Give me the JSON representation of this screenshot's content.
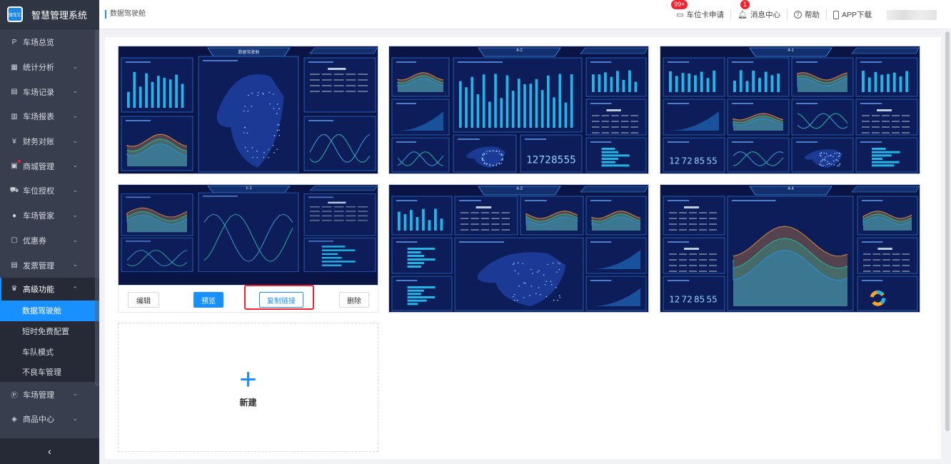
{
  "app": {
    "title": "智慧管理系统",
    "logo_text": "驿车汇"
  },
  "sidebar": {
    "items": [
      {
        "label": "车场总览",
        "icon": "parking-overview-icon"
      },
      {
        "label": "统计分析",
        "icon": "chart-icon"
      },
      {
        "label": "车场记录",
        "icon": "record-icon"
      },
      {
        "label": "车场报表",
        "icon": "report-icon"
      },
      {
        "label": "财务对账",
        "icon": "finance-icon"
      },
      {
        "label": "商城管理",
        "icon": "store-icon"
      },
      {
        "label": "车位授权",
        "icon": "car-icon"
      },
      {
        "label": "车场管家",
        "icon": "user-icon"
      },
      {
        "label": "优惠券",
        "icon": "coupon-icon"
      },
      {
        "label": "发票管理",
        "icon": "invoice-icon"
      }
    ],
    "open_group": {
      "label": "高级功能",
      "icon": "crown-icon",
      "children": [
        "数据驾驶舱",
        "短时免费配置",
        "车队模式",
        "不良车管理"
      ]
    },
    "after": [
      {
        "label": "车场管理",
        "icon": "parking-icon"
      },
      {
        "label": "商品中心",
        "icon": "layers-icon"
      }
    ],
    "collapse": "‹"
  },
  "header": {
    "breadcrumb": "数据驾驶舱",
    "items": [
      {
        "label": "车位卡申请",
        "badge": "99+"
      },
      {
        "label": "消息中心",
        "badge": "1"
      },
      {
        "label": "帮助"
      },
      {
        "label": "APP下载"
      }
    ]
  },
  "dashboards": [
    {
      "title": "数据驾驶舱"
    },
    {
      "title": "4-2"
    },
    {
      "title": "4-1"
    },
    {
      "title": "1-1"
    },
    {
      "title": "4-3"
    },
    {
      "title": "4-4"
    }
  ],
  "actions": {
    "edit": "编辑",
    "preview": "预览",
    "copy_link": "复制链接",
    "delete": "删除"
  },
  "new_card": {
    "plus": "+",
    "label": "新建"
  },
  "colors": {
    "accent": "#1890ff",
    "sidebar": "#393e4e",
    "danger": "#f5222d"
  }
}
